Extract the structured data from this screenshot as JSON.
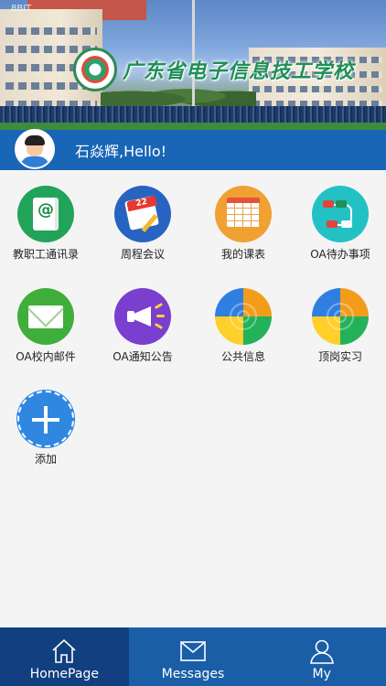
{
  "status_bar": {
    "carrier": "8BIT"
  },
  "banner": {
    "school_name": "广东省电子信息技工学校"
  },
  "user": {
    "greeting": "石焱辉,Hello!"
  },
  "apps": [
    {
      "label": "教职工通讯录",
      "icon": "contacts-book-icon"
    },
    {
      "label": "周程会议",
      "icon": "calendar-meeting-icon"
    },
    {
      "label": "我的课表",
      "icon": "timetable-icon"
    },
    {
      "label": "OA待办事项",
      "icon": "workflow-todo-icon"
    },
    {
      "label": "OA校内邮件",
      "icon": "mail-envelope-icon"
    },
    {
      "label": "OA通知公告",
      "icon": "megaphone-icon"
    },
    {
      "label": "公共信息",
      "icon": "pie-info-icon"
    },
    {
      "label": "顶岗实习",
      "icon": "pie-internship-icon"
    },
    {
      "label": "添加",
      "icon": "plus-icon"
    }
  ],
  "bottom_nav": [
    {
      "label": "HomePage",
      "icon": "home-icon",
      "active": true
    },
    {
      "label": "Messages",
      "icon": "envelope-icon",
      "active": false
    },
    {
      "label": "My",
      "icon": "person-icon",
      "active": false
    }
  ],
  "colors": {
    "primary": "#1965b6",
    "nav_bg": "#1a5ea8",
    "nav_active": "#123f7f",
    "background": "#f4f4f5"
  }
}
